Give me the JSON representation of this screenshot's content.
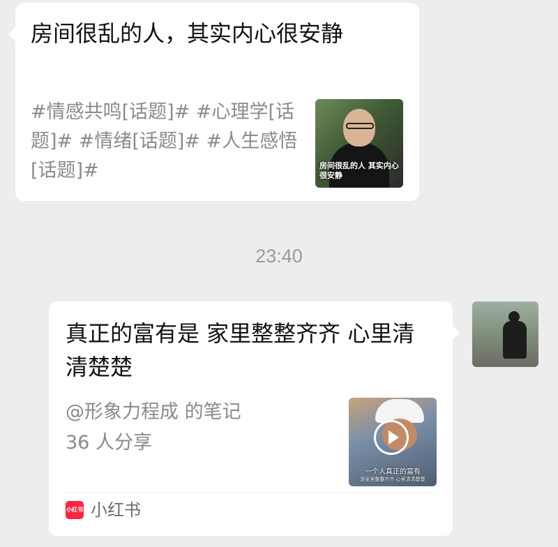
{
  "message1": {
    "title": "房间很乱的人，其实内心很安静",
    "subtitle": "#情感共鸣[话题]# #心理学[话题]# #情绪[话题]# #人生感悟[话题]#",
    "thumbnail_caption": "房间很乱的人 其实内心很安静",
    "thumbnail_icon": "video-thumbnail-man"
  },
  "timestamp": "23:40",
  "message2": {
    "title": "真正的富有是 家里整整齐齐 心里清清楚楚",
    "author_line": "@形象力程成 的笔记",
    "share_count": "36 人分享",
    "thumbnail_caption": "一个人真正的富有",
    "thumbnail_subcaption": "是家里整整齐齐 心里清清楚楚",
    "app_logo_text": "小红书",
    "app_name": "小红书",
    "app_color": "#ff2442"
  },
  "avatar_icon": "user-avatar"
}
